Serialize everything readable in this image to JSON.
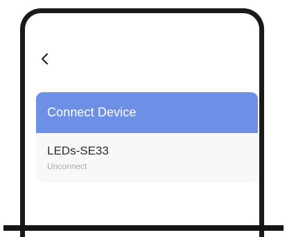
{
  "header": {
    "back_icon": "chevron-left-icon"
  },
  "connect_card": {
    "title": "Connect Device",
    "header_color": "#6d8fe6",
    "devices": [
      {
        "name": "LEDs-SE33",
        "status": "Unconnect"
      }
    ]
  }
}
